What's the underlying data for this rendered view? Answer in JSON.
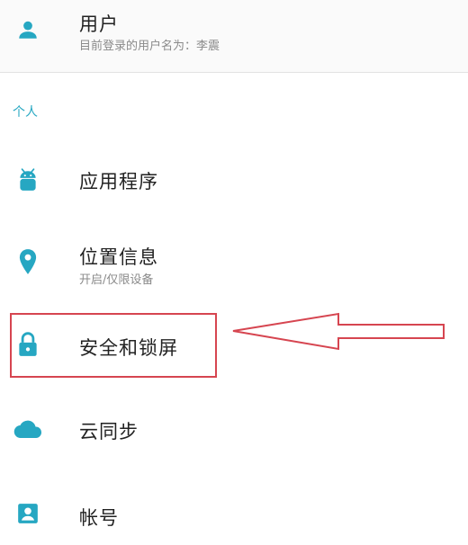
{
  "colors": {
    "accent": "#26a7c2",
    "annotation": "#d64550"
  },
  "user_row": {
    "icon": "person-icon",
    "title": "用户",
    "subtitle": "目前登录的用户名为：李震"
  },
  "section": {
    "header": "个人"
  },
  "items": [
    {
      "icon": "android-icon",
      "label": "应用程序"
    },
    {
      "icon": "location-icon",
      "label": "位置信息",
      "subtitle": "开启/仅限设备"
    },
    {
      "icon": "lock-icon",
      "label": "安全和锁屏"
    },
    {
      "icon": "cloud-icon",
      "label": "云同步"
    },
    {
      "icon": "account-icon",
      "label": "帐号"
    }
  ]
}
